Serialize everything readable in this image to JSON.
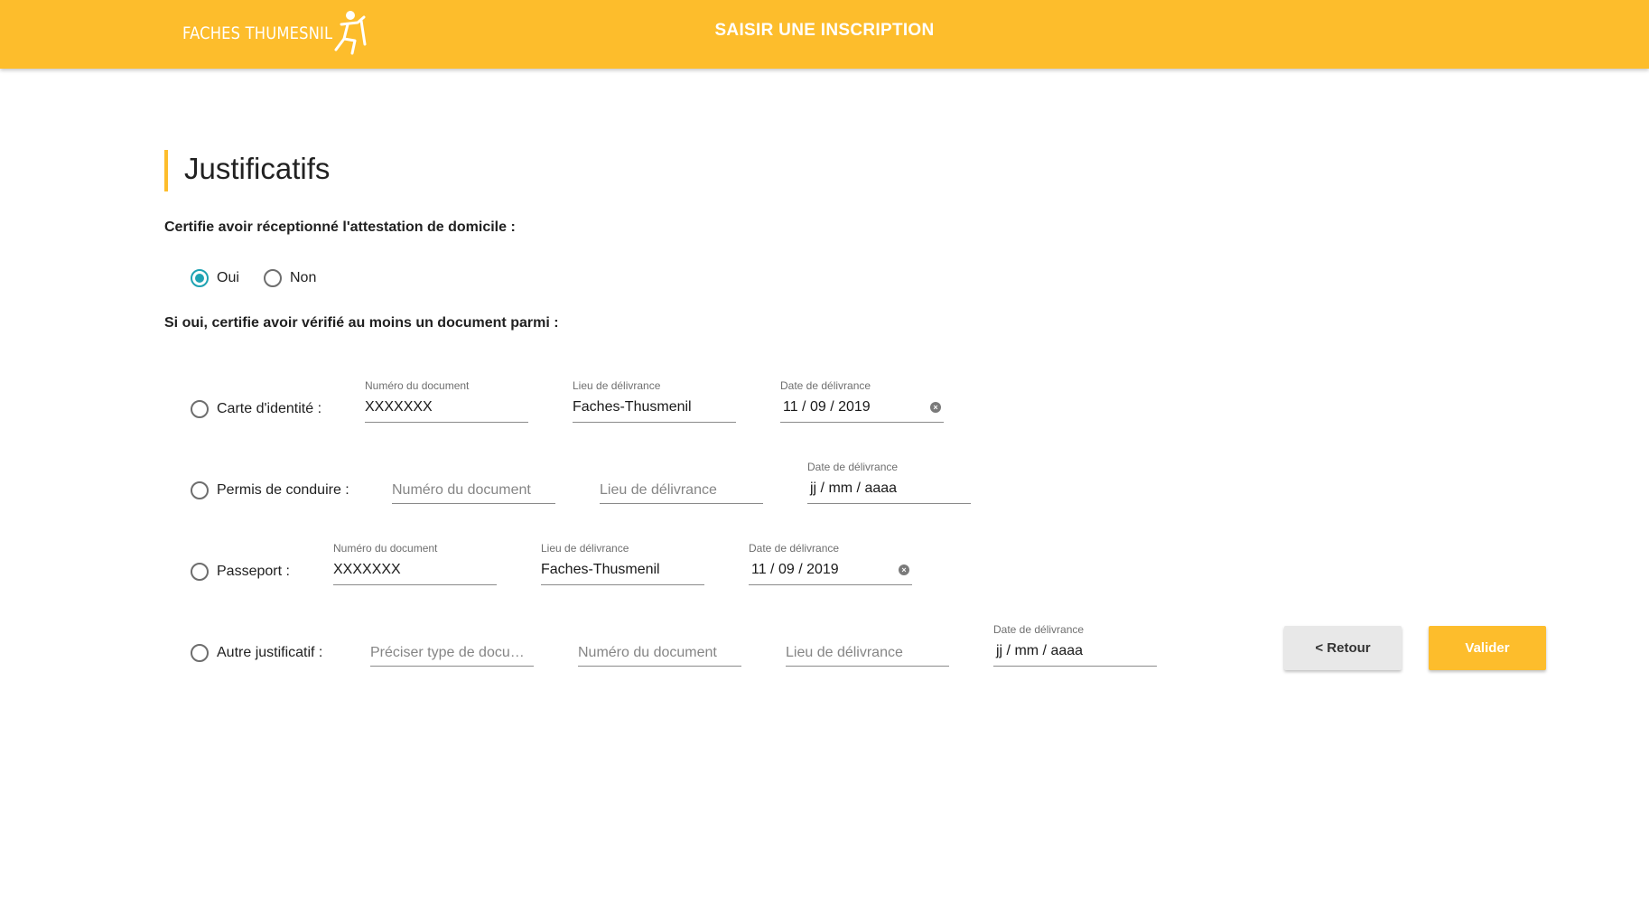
{
  "header": {
    "logo_text": "FACHES THUMESNIL",
    "title": "SAISIR UNE INSCRIPTION",
    "background": "#fdbd2c"
  },
  "section": {
    "title": "Justificatifs"
  },
  "question1": {
    "text": "Certifie avoir réceptionné l'attestation de domicile :",
    "options": [
      {
        "label": "Oui",
        "checked": true
      },
      {
        "label": "Non",
        "checked": false
      }
    ]
  },
  "question2": {
    "text": "Si oui, certifie avoir vérifié au moins un document parmi :"
  },
  "documents": [
    {
      "label": "Carte d'identité :",
      "checked": false,
      "fields": [
        {
          "label": "Numéro du document",
          "value": "XXXXXXX"
        },
        {
          "label": "Lieu de délivrance",
          "value": "Faches-Thusmenil"
        },
        {
          "label": "Date de délivrance",
          "value": "11 / 09 / 2019"
        }
      ]
    },
    {
      "label": "Permis de conduire :",
      "checked": false,
      "fields": [
        {
          "placeholder": "Numéro du document"
        },
        {
          "placeholder": "Lieu de délivrance"
        },
        {
          "label": "Date de délivrance",
          "value": "jj / mm / aaaa"
        }
      ]
    },
    {
      "label": "Passeport :",
      "checked": false,
      "fields": [
        {
          "label": "Numéro du document",
          "value": "XXXXXXX"
        },
        {
          "label": "Lieu de délivrance",
          "value": "Faches-Thusmenil"
        },
        {
          "label": "Date de délivrance",
          "value": "11 / 09 / 2019"
        }
      ]
    },
    {
      "label": "Autre justificatif :",
      "checked": false,
      "fields": [
        {
          "placeholder": "Préciser type de docum..."
        },
        {
          "placeholder": "Numéro du document"
        },
        {
          "placeholder": "Lieu de délivrance"
        },
        {
          "label": "Date de délivrance",
          "value": "jj / mm / aaaa"
        }
      ]
    }
  ],
  "buttons": {
    "back": "< Retour",
    "submit": "Valider"
  },
  "colors": {
    "accent": "#fdbd2c",
    "radio_checked": "#1fa3b3"
  }
}
